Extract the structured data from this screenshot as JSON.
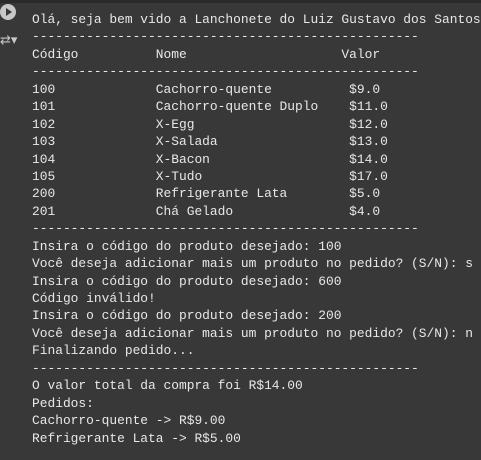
{
  "gutter": {
    "run_icon": "play-circle-icon",
    "output_icon": "output-toggle-icon"
  },
  "output_lines": [
    "Olá, seja bem vido a Lanchonete do Luiz Gustavo dos Santos",
    "--------------------------------------------------",
    "Código          Nome                    Valor",
    "--------------------------------------------------",
    "100             Cachorro-quente          $9.0",
    "101             Cachorro-quente Duplo    $11.0",
    "102             X-Egg                    $12.0",
    "103             X-Salada                 $13.0",
    "104             X-Bacon                  $14.0",
    "105             X-Tudo                   $17.0",
    "200             Refrigerante Lata        $5.0",
    "201             Chá Gelado               $4.0",
    "--------------------------------------------------",
    "Insira o código do produto desejado: 100",
    "Você deseja adicionar mais um produto no pedido? (S/N): s",
    "Insira o código do produto desejado: 600",
    "Código inválido!",
    "Insira o código do produto desejado: 200",
    "Você deseja adicionar mais um produto no pedido? (S/N): n",
    "Finalizando pedido...",
    "--------------------------------------------------",
    "O valor total da compra foi R$14.00",
    "Pedidos:",
    "Cachorro-quente -> R$9.00",
    "Refrigerante Lata -> R$5.00"
  ]
}
